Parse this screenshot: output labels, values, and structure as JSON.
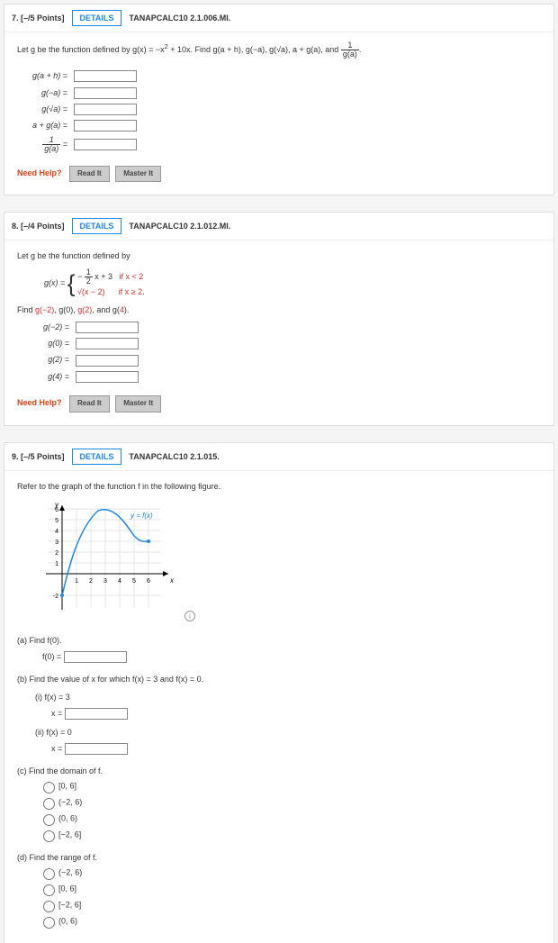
{
  "q7": {
    "num": "7.",
    "pts": "[–/5 Points]",
    "details": "DETAILS",
    "src": "TANAPCALC10 2.1.006.MI.",
    "prompt_a": "Let g be the function defined by g(x) = −x",
    "prompt_b": " + 10x. Find g(a + h), g(−a), g(√a), a + g(a), and ",
    "frac_t": "1",
    "frac_b": "g(a)",
    "period": ".",
    "rows": {
      "r1": "g(a + h)  =",
      "r2": "g(−a)  =",
      "r3": "g(√a)  =",
      "r4": "a + g(a)  =",
      "r5t": "1",
      "r5b": "g(a)",
      "r5eq": "  ="
    }
  },
  "q8": {
    "num": "8.",
    "pts": "[–/4 Points]",
    "details": "DETAILS",
    "src": "TANAPCALC10 2.1.012.MI.",
    "prompt": "Let g be the function defined by",
    "gx": "g(x) = ",
    "p1a": "− ",
    "p1ft": "1",
    "p1fb": "2",
    "p1b": "x + 3",
    "p1c": "if x < 2",
    "p2a": "√(x − 2)",
    "p2b": "if x ≥ 2.",
    "find": "Find g(−2), g(0), g(2), and g(4).",
    "rows": {
      "r1": "g(−2)  =",
      "r2": "g(0)  =",
      "r3": "g(2)  =",
      "r4": "g(4)  ="
    }
  },
  "q9": {
    "num": "9.",
    "pts": "[–/5 Points]",
    "details": "DETAILS",
    "src": "TANAPCALC10 2.1.015.",
    "prompt": "Refer to the graph of the function f in the following figure.",
    "curve_label": "y = f(x)",
    "a": "(a)   Find f(0).",
    "a_lbl": "f(0)  =",
    "b": "(b)   Find the value of x for which f(x) = 3 and f(x) = 0.",
    "bi": "(i)   f(x) = 3",
    "bi_lbl": "x  =",
    "bii": "(ii)   f(x) = 0",
    "bii_lbl": "x  =",
    "c": "(c)   Find the domain of f.",
    "c_opts": [
      "[0, 6]",
      "(−2, 6)",
      "(0, 6)",
      "[−2, 6]"
    ],
    "d": "(d)   Find the range of f.",
    "d_opts": [
      "(−2, 6)",
      "[0, 6]",
      "[−2, 6]",
      "(0, 6)"
    ]
  },
  "nh": {
    "label": "Need Help?",
    "read": "Read It",
    "master": "Master It"
  },
  "chart_data": {
    "type": "line",
    "title": "",
    "xlabel": "x",
    "ylabel": "y",
    "xlim": [
      -1,
      7
    ],
    "ylim": [
      -3,
      7
    ],
    "xticks": [
      1,
      2,
      3,
      4,
      5,
      6
    ],
    "yticks": [
      -2,
      1,
      2,
      3,
      4,
      5,
      6
    ],
    "series": [
      {
        "name": "y = f(x)",
        "points": [
          [
            0,
            -2
          ],
          [
            0.5,
            0
          ],
          [
            1,
            2.5
          ],
          [
            1.5,
            4.5
          ],
          [
            2,
            5.6
          ],
          [
            2.5,
            6
          ],
          [
            3,
            5.8
          ],
          [
            3.5,
            5.2
          ],
          [
            4,
            4.3
          ],
          [
            4.5,
            3.6
          ],
          [
            5,
            3.1
          ],
          [
            5.5,
            3
          ],
          [
            6,
            3
          ]
        ]
      }
    ]
  }
}
